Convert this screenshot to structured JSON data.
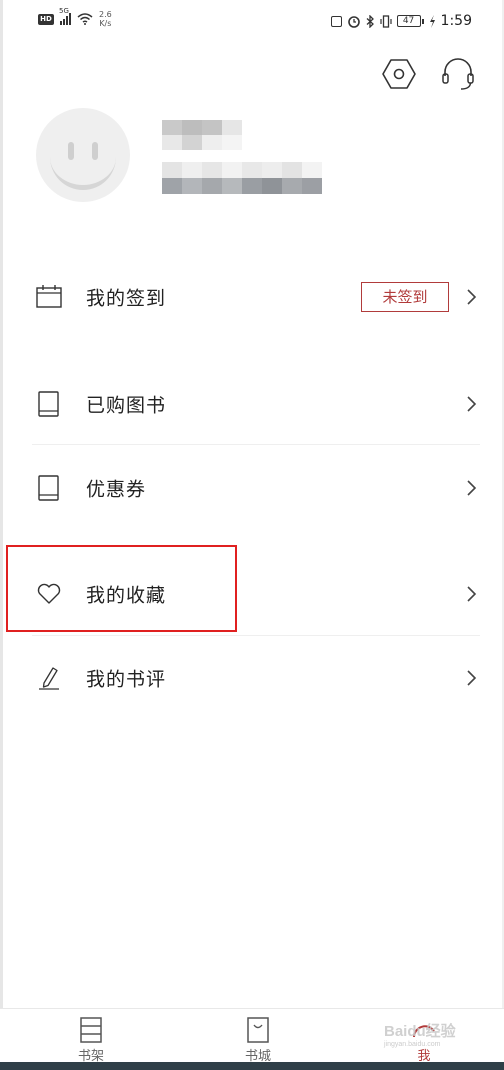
{
  "status_bar": {
    "hd_badge": "HD",
    "network_type": "5G",
    "net_speed_value": "2.6",
    "net_speed_unit": "K/s",
    "battery_level": "47",
    "time": "1:59"
  },
  "header": {
    "settings_icon": "hexagon-settings-icon",
    "service_icon": "headset-icon"
  },
  "profile": {
    "avatar_icon": "smiley-avatar-icon",
    "username_blurred": true,
    "user_id_blurred": true
  },
  "menu": {
    "checkin": {
      "label": "我的签到",
      "badge": "未签到",
      "icon": "calendar-icon"
    },
    "purchased": {
      "label": "已购图书",
      "icon": "book-icon"
    },
    "coupons": {
      "label": "优惠券",
      "icon": "book-icon"
    },
    "favorites": {
      "label": "我的收藏",
      "icon": "heart-icon"
    },
    "reviews": {
      "label": "我的书评",
      "icon": "pencil-icon"
    }
  },
  "bottom_nav": {
    "tabs": [
      {
        "label": "书架",
        "icon": "bookshelf-icon",
        "active": false
      },
      {
        "label": "书城",
        "icon": "bag-icon",
        "active": false
      },
      {
        "label": "我",
        "icon": "profile-icon",
        "active": true
      }
    ]
  },
  "watermark": {
    "brand": "Baidu经验",
    "sub": "jingyan.baidu.com"
  },
  "colors": {
    "accent": "#b13b3b",
    "highlight": "#e02020",
    "text": "#222222",
    "divider": "#efefef"
  }
}
